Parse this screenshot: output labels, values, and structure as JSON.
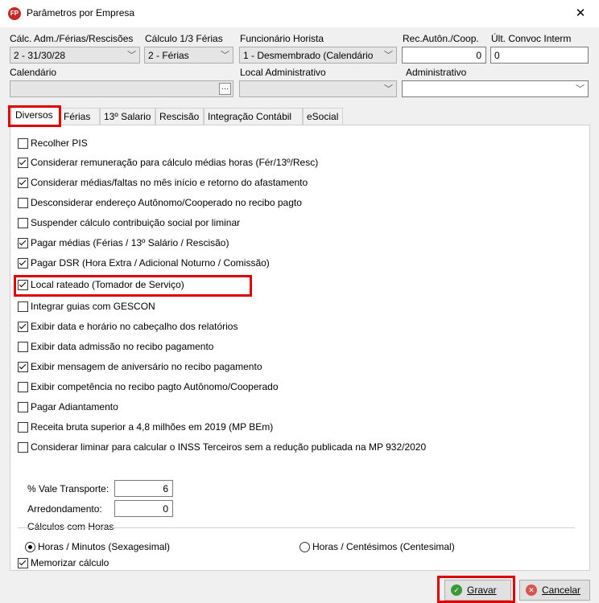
{
  "window": {
    "title": "Parâmetros por Empresa",
    "icon_text": "FP",
    "close": "✕"
  },
  "fields": {
    "calc_adm_label": "Cálc. Adm./Férias/Rescisões",
    "calc_adm_value": "2  -  31/30/28",
    "calculo_ferias_label": "Cálculo 1/3 Férias",
    "calculo_ferias_value": "2  -  Férias",
    "funcionario_horista_label": "Funcionário Horista",
    "funcionario_horista_value": "1  -  Desmembrado (Calendário",
    "rec_auton_label": "Rec.Autôn./Coop.",
    "rec_auton_value": "0",
    "ult_convoc_label": "Últ. Convoc Interm",
    "ult_convoc_value": "0",
    "calendario_label": "Calendário",
    "calendario_value": "",
    "local_adm_label": "Local Administrativo",
    "local_adm_value": "",
    "administrativo_label": "Administrativo",
    "administrativo_value": ""
  },
  "tabs": [
    {
      "label": "Diversos",
      "active": true
    },
    {
      "label": "Férias"
    },
    {
      "label": "13º Salario"
    },
    {
      "label": "Rescisão"
    },
    {
      "label": "Integração Contábil"
    },
    {
      "label": "eSocial"
    }
  ],
  "checkboxes": [
    {
      "label": "Recolher PIS",
      "checked": false
    },
    {
      "label": "Considerar remuneração para cálculo médias horas (Fér/13º/Resc)",
      "checked": true
    },
    {
      "label": "Considerar médias/faltas no mês início e retorno do afastamento",
      "checked": true
    },
    {
      "label": "Desconsiderar endereço Autônomo/Cooperado no recibo pagto",
      "checked": false
    },
    {
      "label": "Suspender cálculo contribuição social por liminar",
      "checked": false
    },
    {
      "label": "Pagar médias (Férias / 13º Salário / Rescisão)",
      "checked": true
    },
    {
      "label": "Pagar DSR (Hora Extra / Adicional Noturno / Comissão)",
      "checked": true
    },
    {
      "label": "Local rateado (Tomador de Serviço)",
      "checked": true
    },
    {
      "label": "Integrar guias com GESCON",
      "checked": false
    },
    {
      "label": "Exibir data e horário no cabeçalho dos relatórios",
      "checked": true
    },
    {
      "label": "Exibir data admissão no recibo pagamento",
      "checked": false
    },
    {
      "label": "Exibir mensagem de aniversário no recibo pagamento",
      "checked": true
    },
    {
      "label": "Exibir competência no recibo pagto Autônomo/Cooperado",
      "checked": false
    },
    {
      "label": "Pagar Adiantamento",
      "checked": false
    },
    {
      "label": "Receita bruta superior a 4,8 milhões em 2019 (MP BEm)",
      "checked": false
    },
    {
      "label": "Considerar liminar para calcular o INSS Terceiros sem a redução publicada na MP 932/2020",
      "checked": false
    }
  ],
  "vale_transporte": {
    "label": "% Vale Transporte:",
    "value": "6"
  },
  "arredondamento": {
    "label": "Arredondamento:",
    "value": "0"
  },
  "calculos_horas": {
    "group_label": "Cálculos com Horas",
    "option1": "Horas / Minutos (Sexagesimal)",
    "option2": "Horas / Centésimos (Centesimal)",
    "selected": "option1"
  },
  "memorizar": {
    "label": "Memorizar cálculo",
    "checked": true
  },
  "buttons": {
    "gravar": "Gravar",
    "cancelar": "Cancelar"
  },
  "colors": {
    "highlight": "#e00000",
    "gravar_icon": "#3a9a3a",
    "cancelar_icon": "#d9534f"
  }
}
